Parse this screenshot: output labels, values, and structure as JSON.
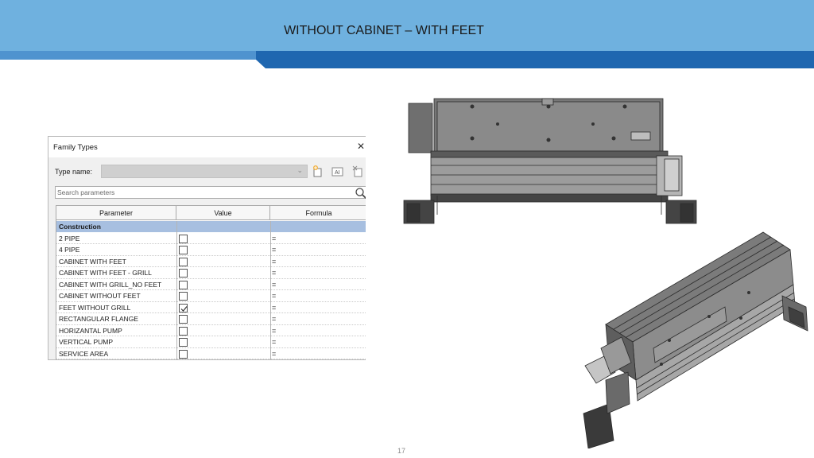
{
  "slide": {
    "title": "WITHOUT CABINET – WITH FEET",
    "page_number": "17",
    "colors": {
      "header_light": "#6fb1df",
      "header_dark": "#1f67b0",
      "selected_row": "#a7bfe0"
    }
  },
  "dialog": {
    "title": "Family Types",
    "close_icon": "close-icon",
    "type_name_label": "Type name:",
    "type_name_value": "",
    "tool_icons": [
      "new-type-icon",
      "rename-type-icon",
      "delete-type-icon"
    ],
    "search_placeholder": "Search parameters",
    "columns": [
      "Parameter",
      "Value",
      "Formula"
    ],
    "group": "Construction",
    "rows": [
      {
        "param": "2 PIPE",
        "checked": false,
        "formula": "="
      },
      {
        "param": "4 PIPE",
        "checked": false,
        "formula": "="
      },
      {
        "param": "CABINET WITH FEET",
        "checked": false,
        "formula": "="
      },
      {
        "param": "CABINET WITH FEET - GRILL",
        "checked": false,
        "formula": "="
      },
      {
        "param": "CABINET WITH GRILL_NO FEET",
        "checked": false,
        "formula": "="
      },
      {
        "param": "CABINET WITHOUT FEET",
        "checked": false,
        "formula": "="
      },
      {
        "param": "FEET WITHOUT GRILL",
        "checked": true,
        "formula": "="
      },
      {
        "param": "RECTANGULAR FLANGE",
        "checked": false,
        "formula": "="
      },
      {
        "param": "HORIZANTAL PUMP",
        "checked": false,
        "formula": "="
      },
      {
        "param": "VERTICAL PUMP",
        "checked": false,
        "formula": "="
      },
      {
        "param": "SERVICE AREA",
        "checked": false,
        "formula": "="
      }
    ]
  }
}
